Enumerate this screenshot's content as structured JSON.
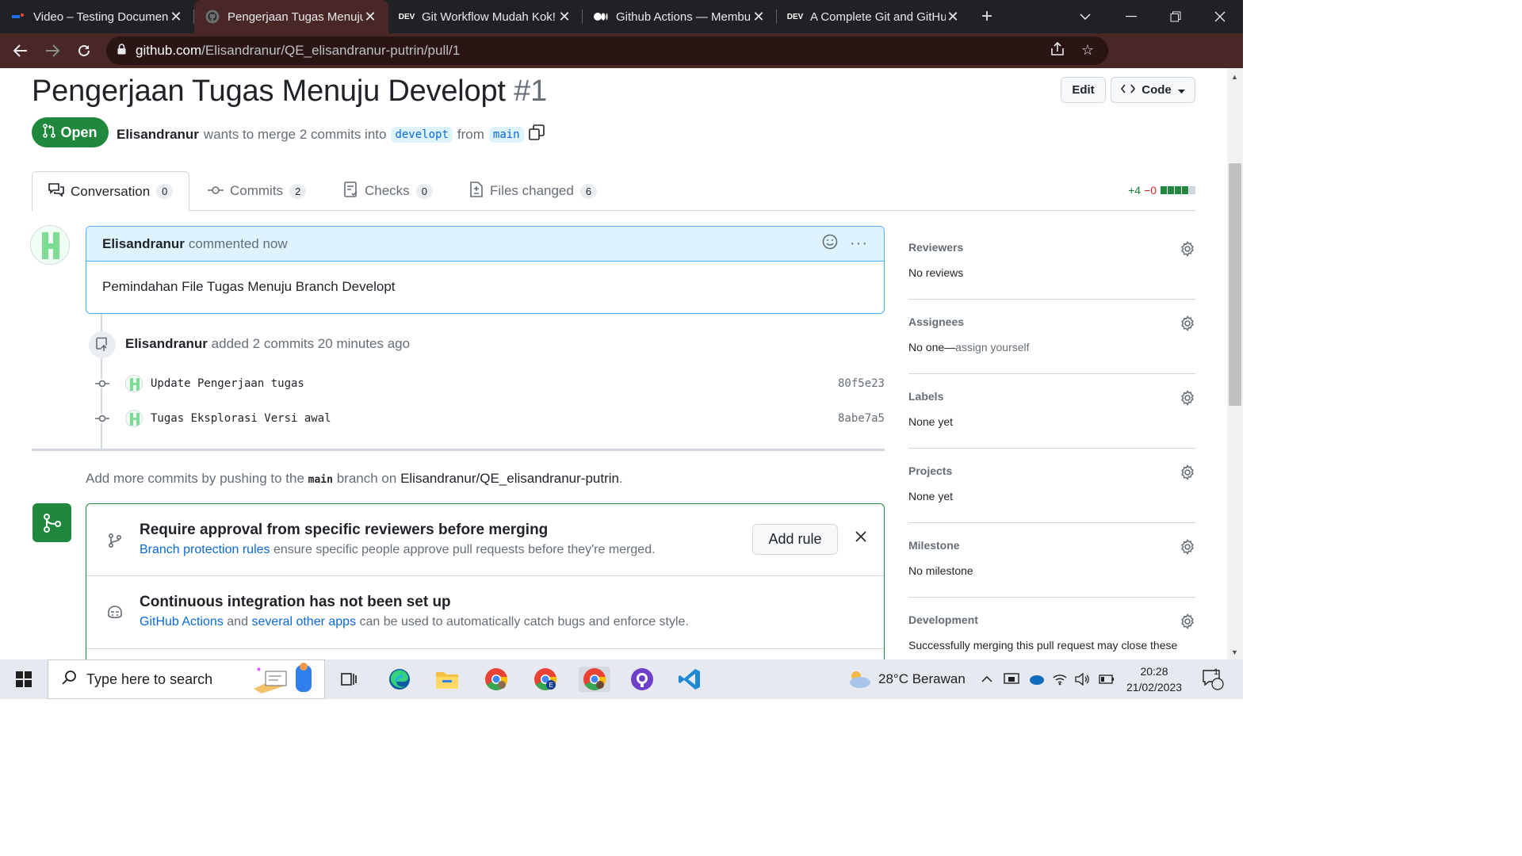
{
  "browser": {
    "tabs": [
      {
        "title": "Video – Testing Documen",
        "icon": "video-favicon-icon"
      },
      {
        "title": "Pengerjaan Tugas Menuju",
        "icon": "github-favicon-icon"
      },
      {
        "title": "Git Workflow Mudah Kok!",
        "icon": "dev-favicon-icon",
        "icon_text": "DEV"
      },
      {
        "title": "Github Actions — Membu",
        "icon": "medium-favicon-icon"
      },
      {
        "title": "A Complete Git and GitHu",
        "icon": "dev-favicon-icon",
        "icon_text": "DEV"
      }
    ],
    "url_host": "github.com",
    "url_path": "/Elisandranur/QE_elisandranur-putrin/pull/1"
  },
  "pr": {
    "title": "Pengerjaan Tugas Menuju Developt",
    "number": "#1",
    "edit_label": "Edit",
    "code_label": "Code",
    "state": "Open",
    "author": "Elisandranur",
    "merge_text": "wants to merge 2 commits into",
    "base_branch": "developt",
    "from_text": "from",
    "head_branch": "main"
  },
  "tabs": [
    {
      "label": "Conversation",
      "count": "0"
    },
    {
      "label": "Commits",
      "count": "2"
    },
    {
      "label": "Checks",
      "count": "0"
    },
    {
      "label": "Files changed",
      "count": "6"
    }
  ],
  "diffstat": {
    "additions": "+4",
    "deletions": "−0",
    "blocks": [
      1,
      1,
      1,
      1,
      0
    ]
  },
  "comment": {
    "author": "Elisandranur",
    "meta": "commented now",
    "body": "Pemindahan File Tugas Menuju Branch Developt"
  },
  "timeline": {
    "author": "Elisandranur",
    "text": "added 2 commits 20 minutes ago",
    "commits": [
      {
        "message": "Update Pengerjaan tugas",
        "sha": "80f5e23"
      },
      {
        "message": "Tugas Eksplorasi Versi awal",
        "sha": "8abe7a5"
      }
    ]
  },
  "add_more": {
    "prefix": "Add more commits by pushing to the",
    "branch": "main",
    "middle": "branch on",
    "repo": "Elisandranur/QE_elisandranur-putrin",
    "suffix": "."
  },
  "merge_box": {
    "approval_title": "Require approval from specific reviewers before merging",
    "approval_link": "Branch protection rules",
    "approval_desc": "ensure specific people approve pull requests before they're merged.",
    "add_rule_label": "Add rule",
    "ci_title": "Continuous integration has not been set up",
    "ci_link1": "GitHub Actions",
    "ci_and": "and",
    "ci_link2": "several other apps",
    "ci_desc": "can be used to automatically catch bugs and enforce style."
  },
  "sidebar": [
    {
      "label": "Reviewers",
      "value": "No reviews"
    },
    {
      "label": "Assignees",
      "value": "No one—",
      "link": "assign yourself"
    },
    {
      "label": "Labels",
      "value": "None yet"
    },
    {
      "label": "Projects",
      "value": "None yet"
    },
    {
      "label": "Milestone",
      "value": "No milestone"
    },
    {
      "label": "Development",
      "value": "Successfully merging this pull request may close these"
    }
  ],
  "taskbar": {
    "search_placeholder": "Type here to search",
    "weather": "28°C  Berawan",
    "time": "20:28",
    "date": "21/02/2023",
    "notifications": "1"
  },
  "colors": {
    "open_green": "#1f883d",
    "link_blue": "#0969da",
    "browser_frame": "#4a2727"
  }
}
